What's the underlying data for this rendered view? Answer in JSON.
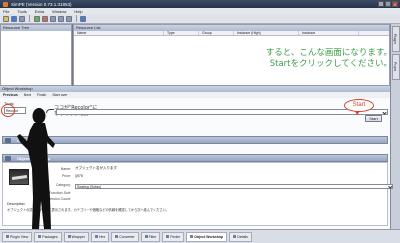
{
  "window": {
    "title": "SimPE (Version 0.73.1.31853)"
  },
  "menu": [
    "File",
    "Tools",
    "Extra",
    "Window",
    "Help"
  ],
  "panels": {
    "resource_tree": "Resource Tree",
    "resource_list": "Resource List",
    "columns": [
      "Name",
      "Type",
      "Group",
      "Instance (High)",
      "Instance"
    ]
  },
  "object_workshop": {
    "title": "Object Workshop",
    "tabs": [
      "Previous",
      "Next",
      "Finish",
      "Start over"
    ],
    "tools_label": "Tools:",
    "preset_value": "Recolor",
    "start_button": "Start",
    "start_callout": "Start",
    "bubble_line1": "ココが\"Recolor\"に",
    "bubble_line2": "なってるか確認！",
    "section_top": "Object Workshop",
    "section_bottom": "Object Workshop",
    "details": {
      "name_label": "Name:",
      "name_value": "オブジェクト名が入ります",
      "price_label": "Price:",
      "price_value": "§975",
      "category_label": "Category:",
      "category_value": "Seating (Sofas)",
      "function_label": "Function Sort:",
      "version_label": "Version Count:",
      "description_label": "Description:",
      "description_text": "オブジェクトの説明文がここに表示されます。カテゴリーや価格などの情報を確認してから次へ進んでください。"
    }
  },
  "overlay": {
    "line1": "すると、こんな画面になります。",
    "line2": "Startをクリックしてください。"
  },
  "statusbar": [
    "Plugin View",
    "Packages",
    "Wrapper",
    "Hex",
    "Converter",
    "Filter",
    "Finder",
    "Object Workshop",
    "Details"
  ]
}
